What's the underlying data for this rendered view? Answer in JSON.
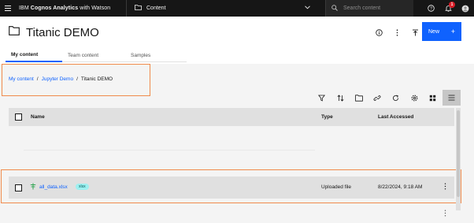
{
  "topbar": {
    "brand_prefix": "IBM ",
    "brand_bold": "Cognos Analytics",
    "brand_suffix": " with Watson",
    "content_label": "Content",
    "search_placeholder": "Search content",
    "notification_count": "1"
  },
  "page": {
    "title": "Titanic DEMO",
    "new_button_label": "New",
    "new_button_icon": "+"
  },
  "tabs": [
    {
      "label": "My content",
      "active": true
    },
    {
      "label": "Team content",
      "active": false
    },
    {
      "label": "Samples",
      "active": false
    }
  ],
  "breadcrumb": {
    "items": [
      "My content",
      "Jupyter Demo",
      "Titanic DEMO"
    ],
    "separator": "/"
  },
  "table": {
    "headers": {
      "name": "Name",
      "type": "Type",
      "last_accessed": "Last Accessed"
    },
    "rows": [
      {
        "name": "all_data.xlsx",
        "tag": "xlsx",
        "type": "Uploaded file",
        "last_accessed": "8/22/2024, 9:18 AM"
      }
    ]
  },
  "colors": {
    "accent": "#0f62fe",
    "highlight": "#f08a4b",
    "topbar": "#161616",
    "tag_bg": "#9ef0f0"
  }
}
